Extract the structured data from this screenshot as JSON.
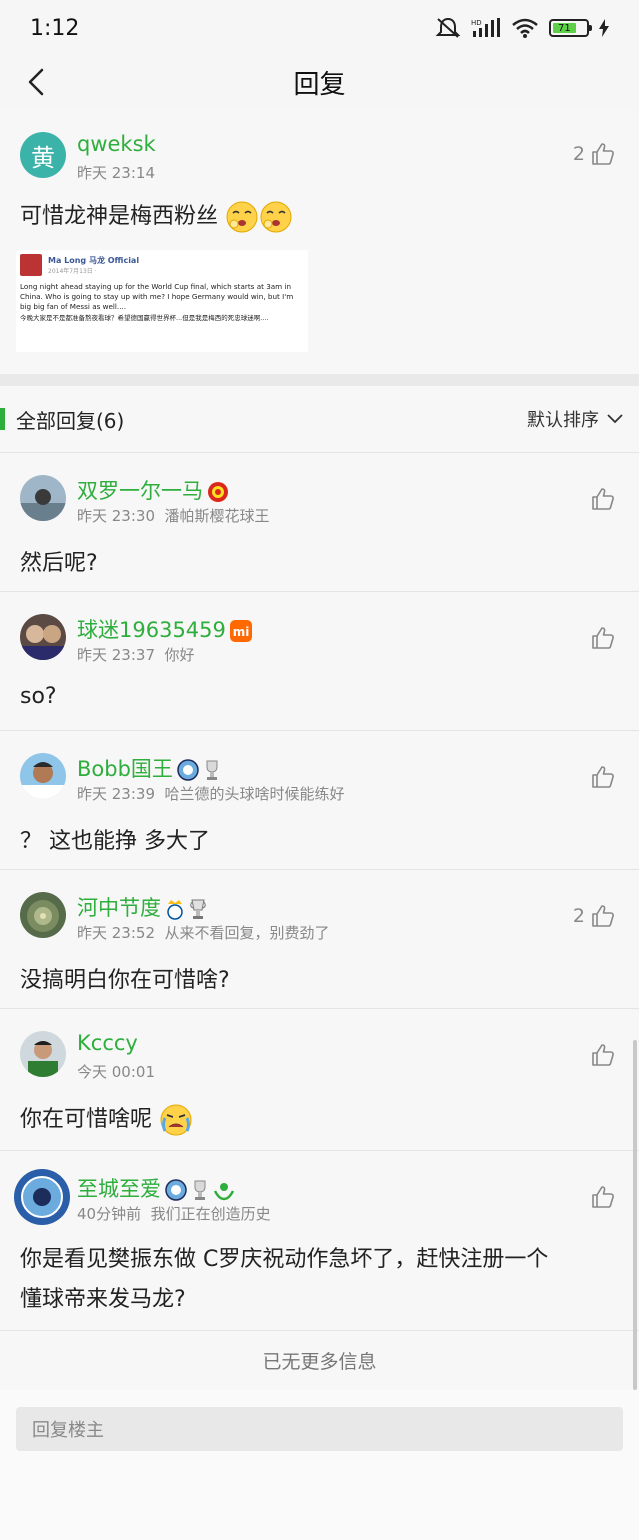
{
  "status": {
    "time": "1:12",
    "battery": "71",
    "network": "HD"
  },
  "nav": {
    "title": "回复"
  },
  "post": {
    "avatar_char": "黄",
    "username": "qweksk",
    "time": "昨天 23:14",
    "likes": "2",
    "text": "可惜龙神是梅西粉丝",
    "embed": {
      "name": "Ma Long 马龙 Official",
      "date": "2014年7月13日 · ",
      "body_en": "Long night ahead staying up for the World Cup final, which starts at 3am in China. Who is going to stay up with me? I hope Germany would win, but I'm big big fan of Messi as well....",
      "body_zh": "今晚大家是不是都准备熬夜看球？希望德国赢得世界杯...但是我是梅西的死忠球迷啊...."
    }
  },
  "replies_header": {
    "title": "全部回复(6)",
    "sort": "默认排序"
  },
  "replies": [
    {
      "username": "双罗一尔一马",
      "time": "昨天 23:30",
      "signature": "潘帕斯樱花球王",
      "text": "然后呢?",
      "likes": ""
    },
    {
      "username": "球迷19635459",
      "time": "昨天 23:37",
      "signature": "你好",
      "text": "so?",
      "likes": ""
    },
    {
      "username": "Bobb国王",
      "time": "昨天 23:39",
      "signature": "哈兰德的头球啥时候能练好",
      "text": "？ 这也能挣 多大了",
      "likes": ""
    },
    {
      "username": "河中节度",
      "time": "昨天 23:52",
      "signature": "从来不看回复，别费劲了",
      "text": "没搞明白你在可惜啥?",
      "likes": "2"
    },
    {
      "username": "Kcccy",
      "time": "今天 00:01",
      "signature": "",
      "text": "你在可惜啥呢",
      "likes": ""
    },
    {
      "username": "至城至爱",
      "time": "40分钟前",
      "signature": "我们正在创造历史",
      "text_line1": "你是看见樊振东做 C罗庆祝动作急坏了，赶快注册一个",
      "text_line2": "懂球帝来发马龙?",
      "likes": ""
    }
  ],
  "footer": {
    "no_more": "已无更多信息",
    "reply_placeholder": "回复楼主"
  },
  "colors": {
    "accent": "#2eae3c",
    "background": "#f7f7f7"
  }
}
